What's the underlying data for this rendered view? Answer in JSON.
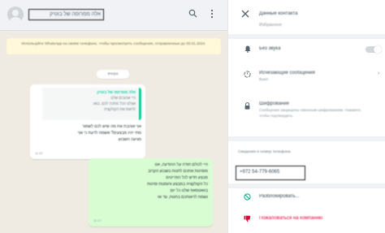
{
  "chat": {
    "contact_name": "אלה ממרוסה של בוטיק",
    "icons": {
      "avatar": "default-avatar",
      "search": "search-icon",
      "menu": "kebab-menu-icon"
    },
    "system_notice": "Используйте WhatsApp на своём телефоне, чтобы просмотреть сообщения, отправленные до 03.01.2024.",
    "date_chip": "вчера",
    "incoming": {
      "quote_author": "אלה ממרוסה של בוטיק",
      "quote_lines": [
        "היי אהובים שלנו",
        "אצלנו הכל מחכה לכם, בואו",
        "לראות את הקולקציה"
      ],
      "text_lines": [
        "אני אוהבת את מה שיש לכם לשמור",
        "מתי יהיו מבצעים? אשמח לדעת כי אני",
        "מגיעה השבוע"
      ],
      "time": "11:02"
    },
    "outgoing": {
      "text_lines": [
        "היי לכולם תודה על ההודעה, אנו",
        "מזמינות אתכם לחנות בשבוע הקרוב",
        "מבצע חדש לכל הפריטים",
        "כל הקולקציה במבצע והזמנות זמינות",
        "בוואטסאפ שלנו כל יום",
        "נשמח לראותכם בחנות, עד אז"
      ],
      "time": "11:17"
    }
  },
  "contact_info": {
    "title": "Данные контакта",
    "partial_row": "Избранное",
    "mute_label": "Без звука",
    "disappearing_label": "Исчезающие сообщения",
    "disappearing_sub": "Выкл.",
    "encryption_label": "Шифрование",
    "encryption_sub": "Сообщения защищены сквозным шифрованием. Нажмите, чтобы подтвердить.",
    "about_title": "Сведения и номер телефона",
    "phone": "+972 54-779-6065",
    "unblock_label": "Разблокировать...",
    "report_label": "Пожаловаться на компанию",
    "colors": {
      "accent": "#00a884",
      "danger": "#ea0038"
    }
  }
}
